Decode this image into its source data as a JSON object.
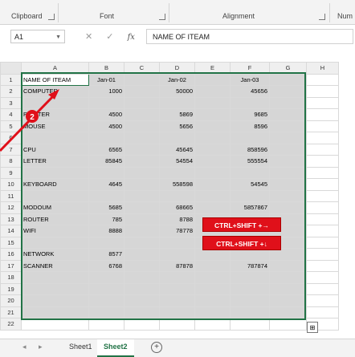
{
  "ribbon": {
    "groups": [
      {
        "label": "Clipboard"
      },
      {
        "label": "Font"
      },
      {
        "label": "Alignment"
      },
      {
        "label": "Num"
      }
    ]
  },
  "formula_bar": {
    "name_box": "A1",
    "fx": "fx",
    "content": "NAME OF ITEAM"
  },
  "columns": [
    "A",
    "B",
    "C",
    "D",
    "E",
    "F",
    "G",
    "H"
  ],
  "rows": [
    {
      "n": "1",
      "a": "NAME OF ITEAM",
      "b": "Jan-01",
      "c": "",
      "d": "Jan-02",
      "e": "",
      "f": "Jan-03"
    },
    {
      "n": "2",
      "a": "COMPUTER",
      "b": "1000",
      "c": "",
      "d": "50000",
      "e": "",
      "f": "45656"
    },
    {
      "n": "3",
      "a": "",
      "b": "",
      "c": "",
      "d": "",
      "e": "",
      "f": ""
    },
    {
      "n": "4",
      "a": "PRINTER",
      "b": "4500",
      "c": "",
      "d": "5869",
      "e": "",
      "f": "9685"
    },
    {
      "n": "5",
      "a": "MOUSE",
      "b": "4500",
      "c": "",
      "d": "5656",
      "e": "",
      "f": "8596"
    },
    {
      "n": "6",
      "a": "",
      "b": "",
      "c": "",
      "d": "",
      "e": "",
      "f": ""
    },
    {
      "n": "7",
      "a": "CPU",
      "b": "6565",
      "c": "",
      "d": "45645",
      "e": "",
      "f": "858596"
    },
    {
      "n": "8",
      "a": "LETTER",
      "b": "85845",
      "c": "",
      "d": "54554",
      "e": "",
      "f": "555554"
    },
    {
      "n": "9",
      "a": "",
      "b": "",
      "c": "",
      "d": "",
      "e": "",
      "f": ""
    },
    {
      "n": "10",
      "a": "KEYBOARD",
      "b": "4645",
      "c": "",
      "d": "558598",
      "e": "",
      "f": "54545"
    },
    {
      "n": "11",
      "a": "",
      "b": "",
      "c": "",
      "d": "",
      "e": "",
      "f": ""
    },
    {
      "n": "12",
      "a": "MODOUM",
      "b": "5685",
      "c": "",
      "d": "68665",
      "e": "",
      "f": "5857867"
    },
    {
      "n": "13",
      "a": "ROUTER",
      "b": "785",
      "c": "",
      "d": "8788",
      "e": "",
      "f": ""
    },
    {
      "n": "14",
      "a": "WIFI",
      "b": "8888",
      "c": "",
      "d": "78778",
      "e": "",
      "f": ""
    },
    {
      "n": "15",
      "a": "",
      "b": "",
      "c": "",
      "d": "",
      "e": "",
      "f": ""
    },
    {
      "n": "16",
      "a": "NETWORK",
      "b": "8577",
      "c": "",
      "d": "",
      "e": "",
      "f": ""
    },
    {
      "n": "17",
      "a": "SCANNER",
      "b": "6768",
      "c": "",
      "d": "87878",
      "e": "",
      "f": "787874"
    },
    {
      "n": "18",
      "a": "",
      "b": "",
      "c": "",
      "d": "",
      "e": "",
      "f": ""
    },
    {
      "n": "19",
      "a": "",
      "b": "",
      "c": "",
      "d": "",
      "e": "",
      "f": ""
    },
    {
      "n": "20",
      "a": "",
      "b": "",
      "c": "",
      "d": "",
      "e": "",
      "f": ""
    },
    {
      "n": "21",
      "a": "",
      "b": "",
      "c": "",
      "d": "",
      "e": "",
      "f": ""
    },
    {
      "n": "22",
      "a": "",
      "b": "",
      "c": "",
      "d": "",
      "e": "",
      "f": ""
    }
  ],
  "callouts": [
    "CTRL+SHIFT +→",
    "CTRL+SHIFT +↓"
  ],
  "step_marker": "2",
  "sheets": [
    {
      "label": "Sheet1",
      "active": false
    },
    {
      "label": "Sheet2",
      "active": true
    }
  ],
  "add_sheet": "+",
  "colors": {
    "accent": "#217346",
    "callout": "#e0101a",
    "selection": "#d6d6d6"
  }
}
